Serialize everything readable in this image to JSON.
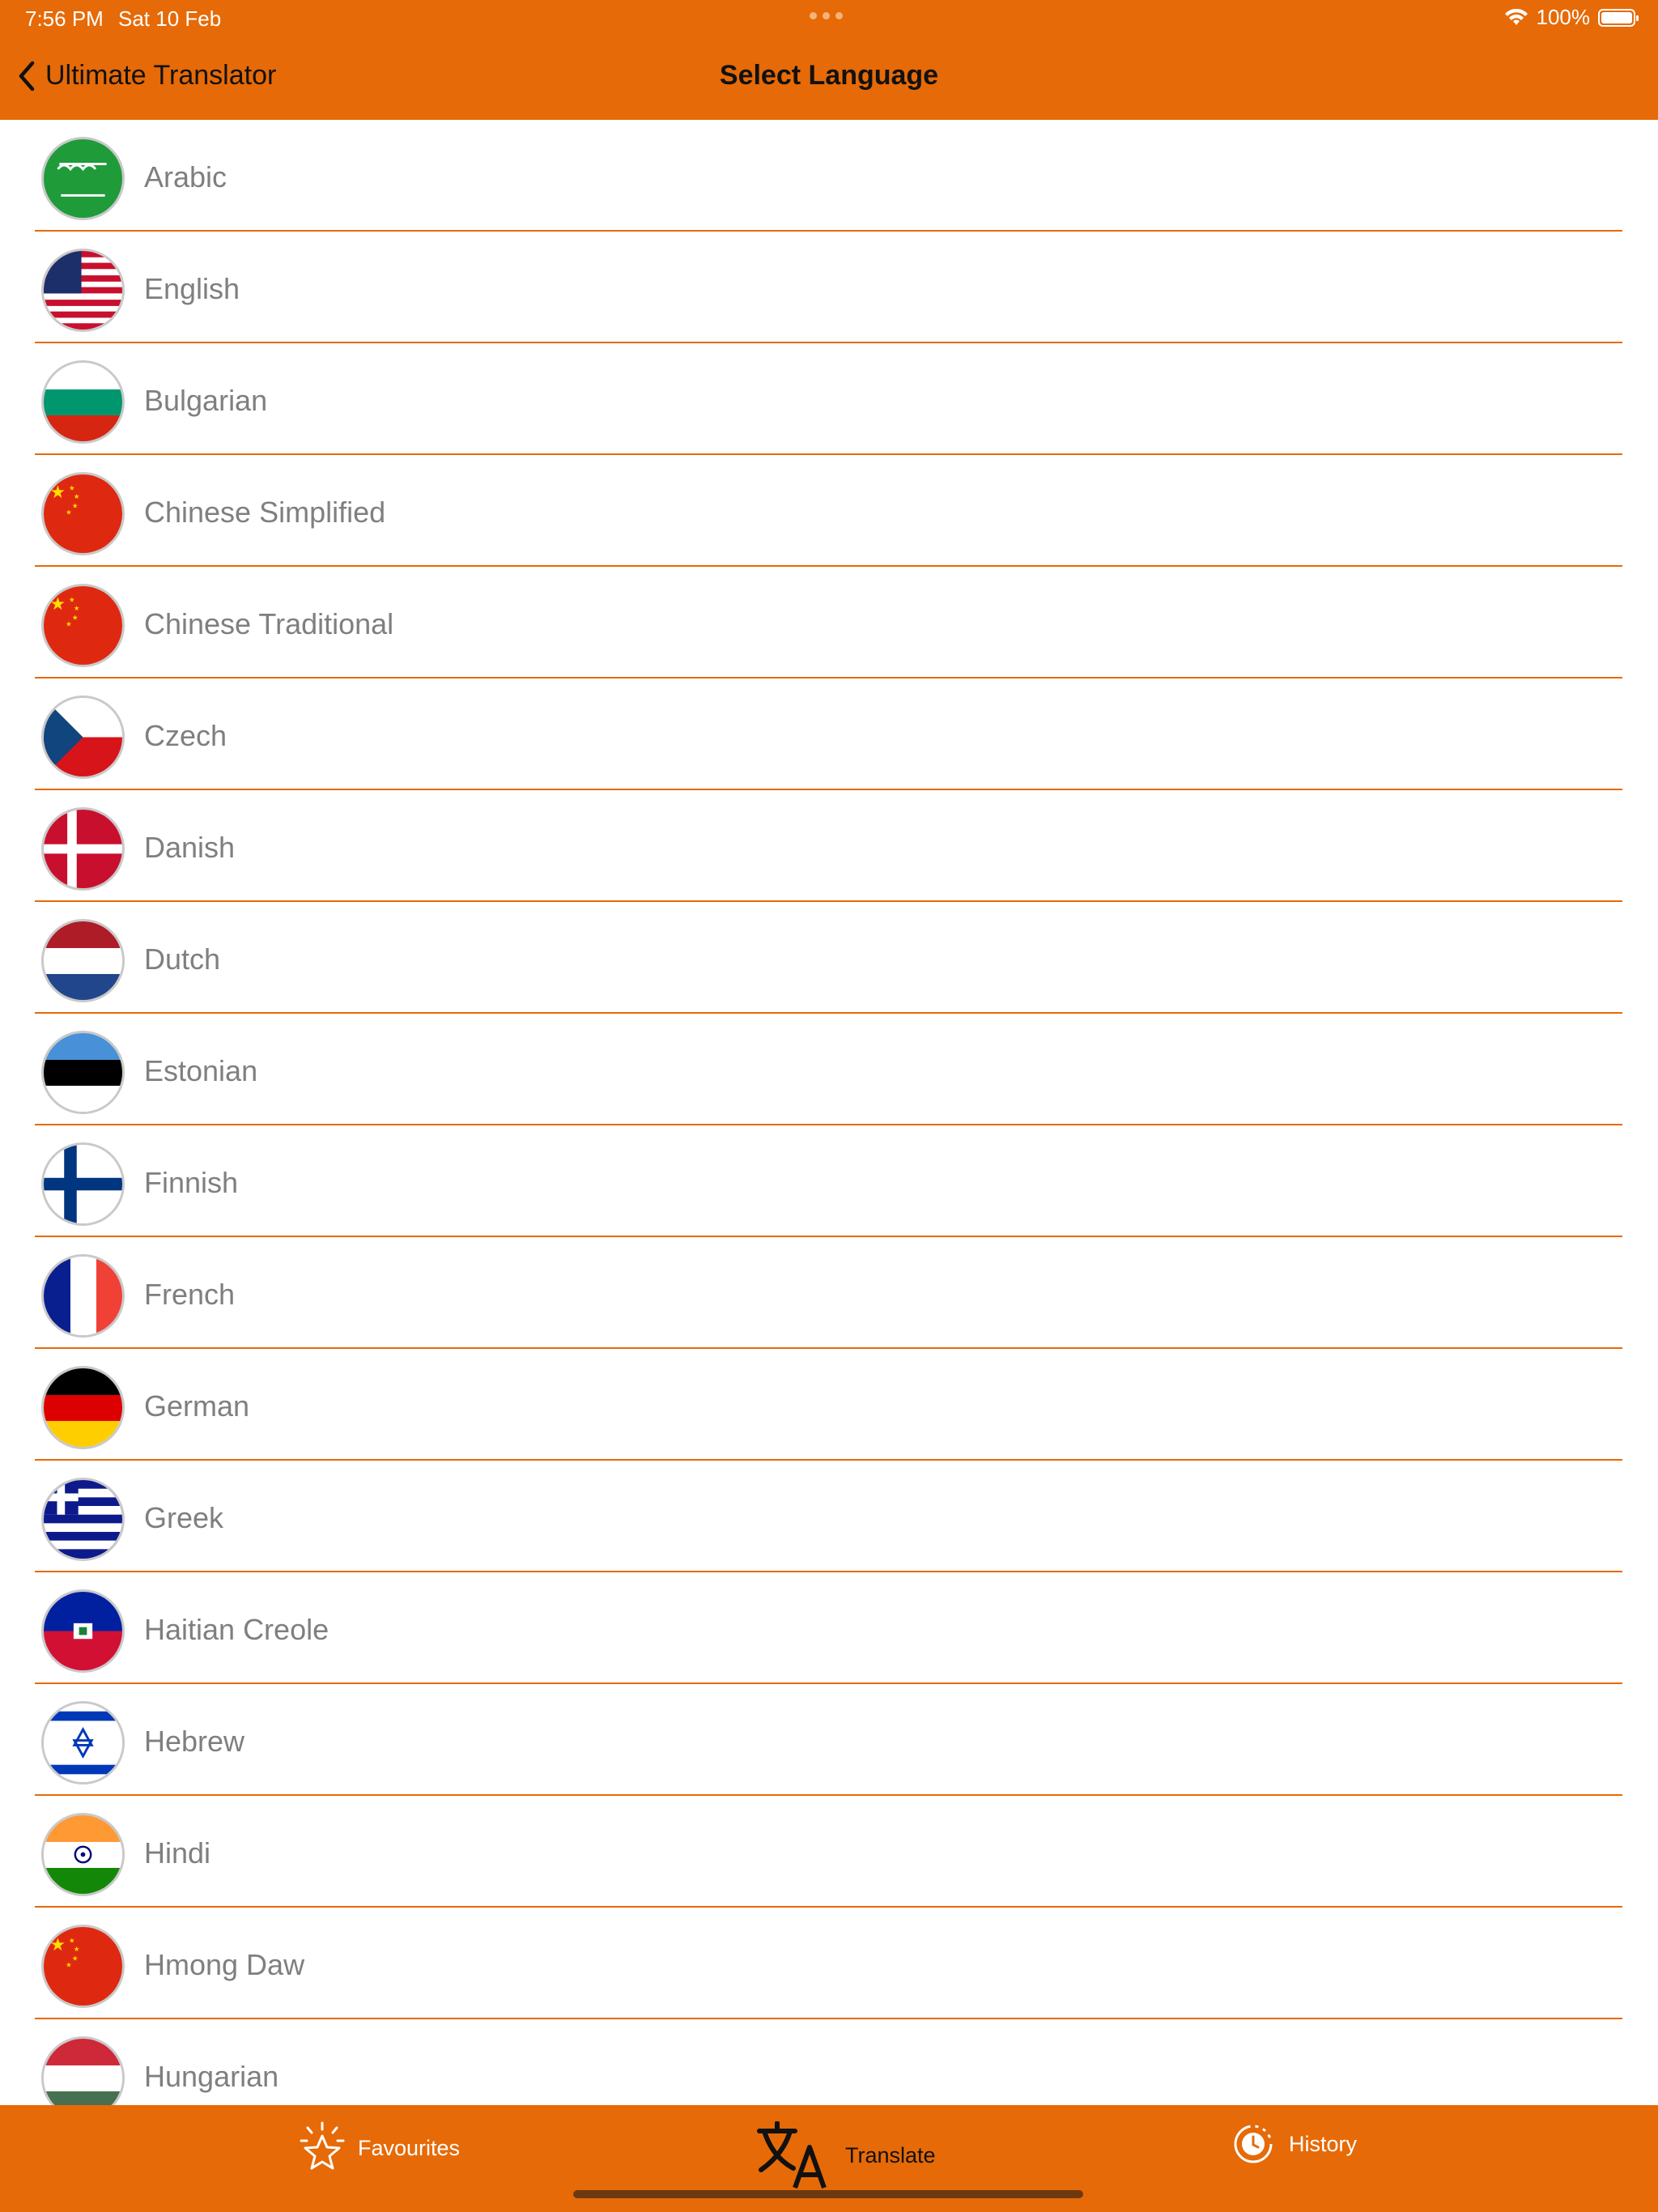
{
  "status_bar": {
    "time": "7:56 PM",
    "date": "Sat 10 Feb",
    "battery": "100%"
  },
  "nav": {
    "back_label": "Ultimate Translator",
    "title": "Select Language"
  },
  "languages": [
    {
      "label": "Arabic",
      "flag": "saudi-arabia-flag-icon"
    },
    {
      "label": "English",
      "flag": "usa-flag-icon"
    },
    {
      "label": "Bulgarian",
      "flag": "bulgaria-flag-icon"
    },
    {
      "label": "Chinese Simplified",
      "flag": "china-flag-icon"
    },
    {
      "label": "Chinese Traditional",
      "flag": "china-flag-icon"
    },
    {
      "label": "Czech",
      "flag": "czech-flag-icon"
    },
    {
      "label": "Danish",
      "flag": "denmark-flag-icon"
    },
    {
      "label": "Dutch",
      "flag": "netherlands-flag-icon"
    },
    {
      "label": "Estonian",
      "flag": "estonia-flag-icon"
    },
    {
      "label": "Finnish",
      "flag": "finland-flag-icon"
    },
    {
      "label": "French",
      "flag": "france-flag-icon"
    },
    {
      "label": "German",
      "flag": "germany-flag-icon"
    },
    {
      "label": "Greek",
      "flag": "greece-flag-icon"
    },
    {
      "label": "Haitian Creole",
      "flag": "haiti-flag-icon"
    },
    {
      "label": "Hebrew",
      "flag": "israel-flag-icon"
    },
    {
      "label": "Hindi",
      "flag": "india-flag-icon"
    },
    {
      "label": "Hmong Daw",
      "flag": "china-flag-icon"
    },
    {
      "label": "Hungarian",
      "flag": "hungary-flag-icon"
    }
  ],
  "tabs": [
    {
      "label": "Favourites",
      "icon": "star-icon",
      "active": false
    },
    {
      "label": "Translate",
      "icon": "translate-icon",
      "active": true
    },
    {
      "label": "History",
      "icon": "clock-icon",
      "active": false
    }
  ],
  "colors": {
    "accent": "#e66a07",
    "text_muted": "#7f7f7f"
  }
}
